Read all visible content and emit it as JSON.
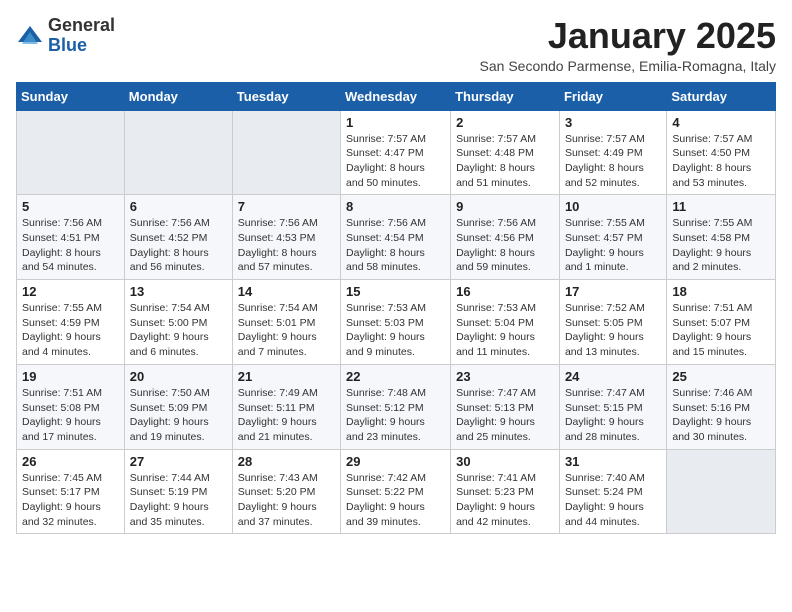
{
  "header": {
    "logo_general": "General",
    "logo_blue": "Blue",
    "month": "January 2025",
    "location": "San Secondo Parmense, Emilia-Romagna, Italy"
  },
  "days_of_week": [
    "Sunday",
    "Monday",
    "Tuesday",
    "Wednesday",
    "Thursday",
    "Friday",
    "Saturday"
  ],
  "weeks": [
    [
      {
        "day": "",
        "info": ""
      },
      {
        "day": "",
        "info": ""
      },
      {
        "day": "",
        "info": ""
      },
      {
        "day": "1",
        "info": "Sunrise: 7:57 AM\nSunset: 4:47 PM\nDaylight: 8 hours\nand 50 minutes."
      },
      {
        "day": "2",
        "info": "Sunrise: 7:57 AM\nSunset: 4:48 PM\nDaylight: 8 hours\nand 51 minutes."
      },
      {
        "day": "3",
        "info": "Sunrise: 7:57 AM\nSunset: 4:49 PM\nDaylight: 8 hours\nand 52 minutes."
      },
      {
        "day": "4",
        "info": "Sunrise: 7:57 AM\nSunset: 4:50 PM\nDaylight: 8 hours\nand 53 minutes."
      }
    ],
    [
      {
        "day": "5",
        "info": "Sunrise: 7:56 AM\nSunset: 4:51 PM\nDaylight: 8 hours\nand 54 minutes."
      },
      {
        "day": "6",
        "info": "Sunrise: 7:56 AM\nSunset: 4:52 PM\nDaylight: 8 hours\nand 56 minutes."
      },
      {
        "day": "7",
        "info": "Sunrise: 7:56 AM\nSunset: 4:53 PM\nDaylight: 8 hours\nand 57 minutes."
      },
      {
        "day": "8",
        "info": "Sunrise: 7:56 AM\nSunset: 4:54 PM\nDaylight: 8 hours\nand 58 minutes."
      },
      {
        "day": "9",
        "info": "Sunrise: 7:56 AM\nSunset: 4:56 PM\nDaylight: 8 hours\nand 59 minutes."
      },
      {
        "day": "10",
        "info": "Sunrise: 7:55 AM\nSunset: 4:57 PM\nDaylight: 9 hours\nand 1 minute."
      },
      {
        "day": "11",
        "info": "Sunrise: 7:55 AM\nSunset: 4:58 PM\nDaylight: 9 hours\nand 2 minutes."
      }
    ],
    [
      {
        "day": "12",
        "info": "Sunrise: 7:55 AM\nSunset: 4:59 PM\nDaylight: 9 hours\nand 4 minutes."
      },
      {
        "day": "13",
        "info": "Sunrise: 7:54 AM\nSunset: 5:00 PM\nDaylight: 9 hours\nand 6 minutes."
      },
      {
        "day": "14",
        "info": "Sunrise: 7:54 AM\nSunset: 5:01 PM\nDaylight: 9 hours\nand 7 minutes."
      },
      {
        "day": "15",
        "info": "Sunrise: 7:53 AM\nSunset: 5:03 PM\nDaylight: 9 hours\nand 9 minutes."
      },
      {
        "day": "16",
        "info": "Sunrise: 7:53 AM\nSunset: 5:04 PM\nDaylight: 9 hours\nand 11 minutes."
      },
      {
        "day": "17",
        "info": "Sunrise: 7:52 AM\nSunset: 5:05 PM\nDaylight: 9 hours\nand 13 minutes."
      },
      {
        "day": "18",
        "info": "Sunrise: 7:51 AM\nSunset: 5:07 PM\nDaylight: 9 hours\nand 15 minutes."
      }
    ],
    [
      {
        "day": "19",
        "info": "Sunrise: 7:51 AM\nSunset: 5:08 PM\nDaylight: 9 hours\nand 17 minutes."
      },
      {
        "day": "20",
        "info": "Sunrise: 7:50 AM\nSunset: 5:09 PM\nDaylight: 9 hours\nand 19 minutes."
      },
      {
        "day": "21",
        "info": "Sunrise: 7:49 AM\nSunset: 5:11 PM\nDaylight: 9 hours\nand 21 minutes."
      },
      {
        "day": "22",
        "info": "Sunrise: 7:48 AM\nSunset: 5:12 PM\nDaylight: 9 hours\nand 23 minutes."
      },
      {
        "day": "23",
        "info": "Sunrise: 7:47 AM\nSunset: 5:13 PM\nDaylight: 9 hours\nand 25 minutes."
      },
      {
        "day": "24",
        "info": "Sunrise: 7:47 AM\nSunset: 5:15 PM\nDaylight: 9 hours\nand 28 minutes."
      },
      {
        "day": "25",
        "info": "Sunrise: 7:46 AM\nSunset: 5:16 PM\nDaylight: 9 hours\nand 30 minutes."
      }
    ],
    [
      {
        "day": "26",
        "info": "Sunrise: 7:45 AM\nSunset: 5:17 PM\nDaylight: 9 hours\nand 32 minutes."
      },
      {
        "day": "27",
        "info": "Sunrise: 7:44 AM\nSunset: 5:19 PM\nDaylight: 9 hours\nand 35 minutes."
      },
      {
        "day": "28",
        "info": "Sunrise: 7:43 AM\nSunset: 5:20 PM\nDaylight: 9 hours\nand 37 minutes."
      },
      {
        "day": "29",
        "info": "Sunrise: 7:42 AM\nSunset: 5:22 PM\nDaylight: 9 hours\nand 39 minutes."
      },
      {
        "day": "30",
        "info": "Sunrise: 7:41 AM\nSunset: 5:23 PM\nDaylight: 9 hours\nand 42 minutes."
      },
      {
        "day": "31",
        "info": "Sunrise: 7:40 AM\nSunset: 5:24 PM\nDaylight: 9 hours\nand 44 minutes."
      },
      {
        "day": "",
        "info": ""
      }
    ]
  ]
}
